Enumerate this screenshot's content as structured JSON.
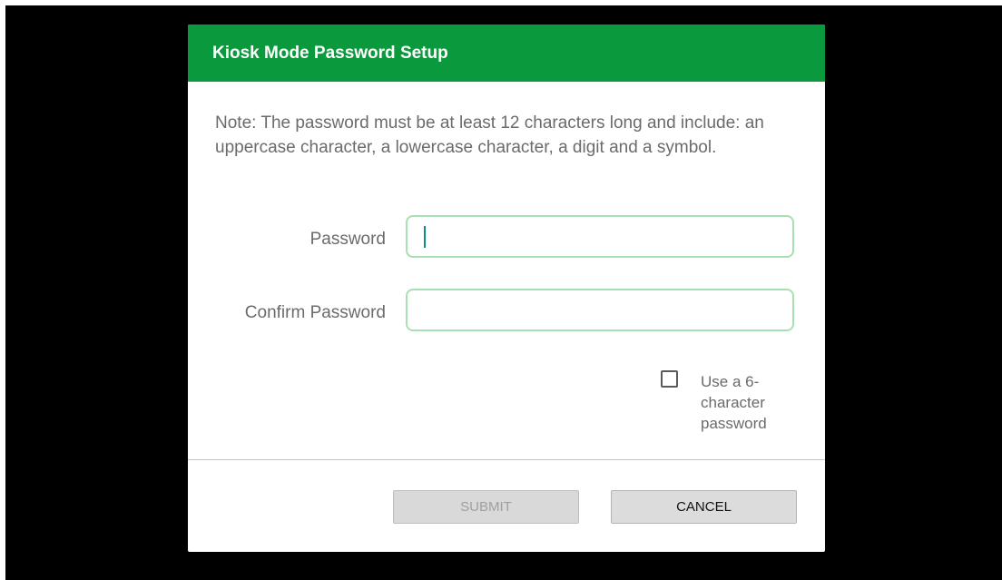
{
  "dialog": {
    "title": "Kiosk Mode Password Setup",
    "note": "Note: The password must be at least 12 characters long and include: an uppercase character, a lowercase character, a digit and a symbol.",
    "password_label": "Password",
    "password_value": "",
    "confirm_label": "Confirm Password",
    "confirm_value": "",
    "checkbox_label": "Use a 6-character password",
    "checkbox_checked": false,
    "submit_label": "SUBMIT",
    "submit_enabled": false,
    "cancel_label": "CANCEL"
  },
  "colors": {
    "header": "#0a9a3d",
    "input_border": "#a6e0b3",
    "caret": "#0f8f86",
    "backdrop": "#000000"
  }
}
